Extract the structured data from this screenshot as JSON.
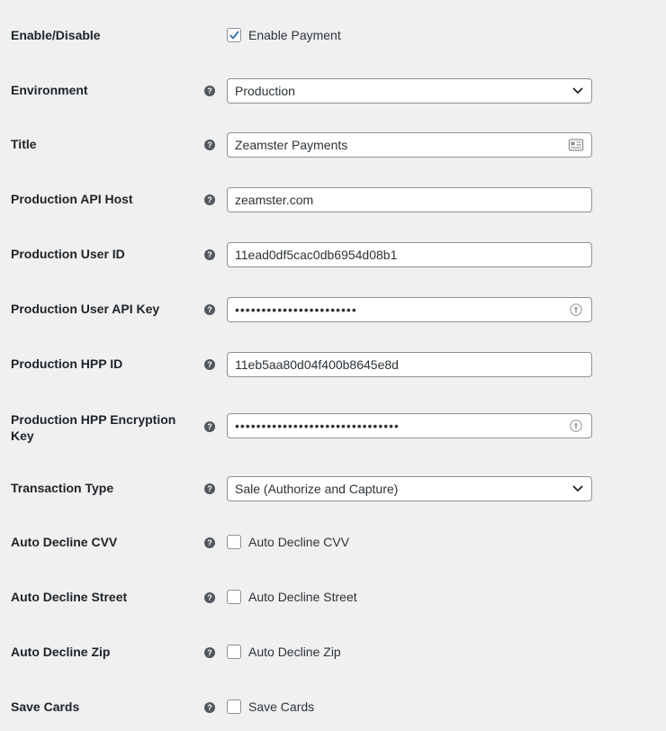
{
  "settings": {
    "enable": {
      "label": "Enable/Disable",
      "checkbox_label": "Enable Payment",
      "checked": true
    },
    "environment": {
      "label": "Environment",
      "value": "Production"
    },
    "title": {
      "label": "Title",
      "value": "Zeamster Payments"
    },
    "api_host": {
      "label": "Production API Host",
      "value": "zeamster.com"
    },
    "user_id": {
      "label": "Production User ID",
      "value": "11ead0df5cac0db6954d08b1"
    },
    "user_api_key": {
      "label": "Production User API Key",
      "value": "•••••••••••••••••••••••"
    },
    "hpp_id": {
      "label": "Production HPP ID",
      "value": "11eb5aa80d04f400b8645e8d"
    },
    "hpp_key": {
      "label": "Production HPP Encryption Key",
      "value": "•••••••••••••••••••••••••••••••"
    },
    "transaction_type": {
      "label": "Transaction Type",
      "value": "Sale (Authorize and Capture)"
    },
    "decline_cvv": {
      "label": "Auto Decline CVV",
      "checkbox_label": "Auto Decline CVV",
      "checked": false
    },
    "decline_street": {
      "label": "Auto Decline Street",
      "checkbox_label": "Auto Decline Street",
      "checked": false
    },
    "decline_zip": {
      "label": "Auto Decline Zip",
      "checkbox_label": "Auto Decline Zip",
      "checked": false
    },
    "save_cards": {
      "label": "Save Cards",
      "checkbox_label": "Save Cards",
      "checked": false
    }
  },
  "help_glyph": "?",
  "icons": {
    "help": "question-circle-icon",
    "select": "chevron-down-icon",
    "title_field": "contact-card-icon",
    "password_field": "key-manager-icon",
    "check": "checkmark-icon"
  },
  "colors": {
    "background": "#f0f0f1",
    "input_border": "#8c8f94",
    "checkbox_accent": "#2271b1",
    "help_icon": "#50575e"
  }
}
